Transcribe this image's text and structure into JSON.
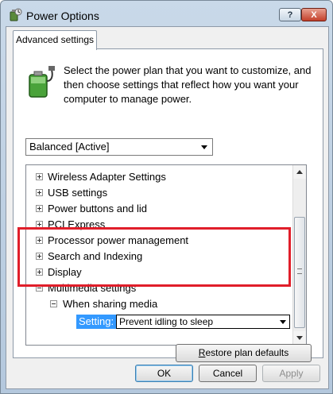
{
  "window": {
    "title": "Power Options",
    "help_label": "?",
    "close_label": "X"
  },
  "tabs": [
    {
      "label": "Advanced settings"
    }
  ],
  "description": "Select the power plan that you want to customize, and then choose settings that reflect how you want your computer to manage power.",
  "plan_select": {
    "value": "Balanced [Active]"
  },
  "tree": {
    "items": [
      {
        "label": "Wireless Adapter Settings",
        "state": "collapsed"
      },
      {
        "label": "USB settings",
        "state": "collapsed"
      },
      {
        "label": "Power buttons and lid",
        "state": "collapsed"
      },
      {
        "label": "PCI Express",
        "state": "collapsed"
      },
      {
        "label": "Processor power management",
        "state": "collapsed"
      },
      {
        "label": "Search and Indexing",
        "state": "collapsed"
      },
      {
        "label": "Display",
        "state": "collapsed"
      },
      {
        "label": "Multimedia settings",
        "state": "expanded"
      },
      {
        "label": "When sharing media",
        "state": "expanded"
      }
    ],
    "setting_label": "Setting:",
    "setting_value": "Prevent idling to sleep"
  },
  "buttons": {
    "restore_first": "R",
    "restore_rest": "estore plan defaults",
    "ok": "OK",
    "cancel": "Cancel",
    "apply": "Apply"
  },
  "colors": {
    "highlight_box": "#e01e2a",
    "selection": "#3399ff"
  }
}
